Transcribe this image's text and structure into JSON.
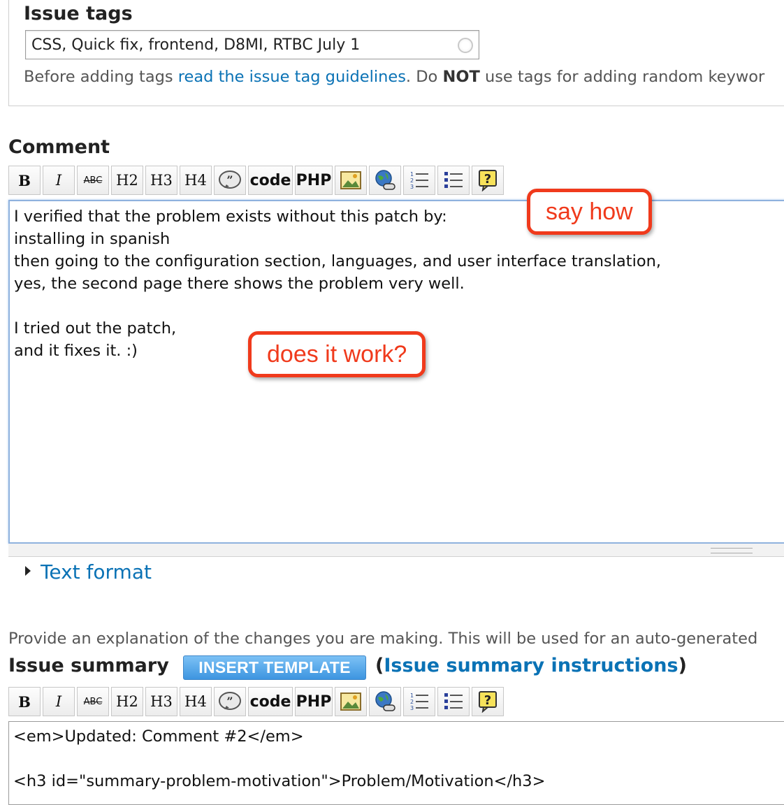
{
  "issue_tags": {
    "label": "Issue tags",
    "value": "CSS, Quick fix, frontend, D8MI, RTBC July 1",
    "help_prefix": "Before adding tags ",
    "help_link": "read the issue tag guidelines",
    "help_mid": ". Do ",
    "help_bold": "NOT",
    "help_suffix": " use tags for adding random keywor"
  },
  "comment": {
    "label": "Comment",
    "text": "I verified that the problem exists without this patch by:\ninstalling in spanish\nthen going to the configuration section, languages, and user interface translation,\nyes, the second page there shows the problem very well.\n\nI tried out the patch,\nand it fixes it. :)"
  },
  "toolbar": {
    "bold": "B",
    "italic": "I",
    "strike": "ABC",
    "h2": "H2",
    "h3": "H3",
    "h4": "H4",
    "code": "code",
    "php": "PHP"
  },
  "icons": [
    "bold-icon",
    "italic-icon",
    "strikethrough-icon",
    "h2-icon",
    "h3-icon",
    "h4-icon",
    "quote-icon",
    "code-icon",
    "php-icon",
    "image-icon",
    "link-icon",
    "ordered-list-icon",
    "bullet-list-icon",
    "help-icon"
  ],
  "callouts": {
    "say_how": "say how",
    "does_it_work": "does it work?"
  },
  "colors": {
    "callout": "#f03a1c",
    "link": "#0a72b5",
    "button": "#3d95e0"
  },
  "text_format": {
    "label": "Text format"
  },
  "summary": {
    "explanation": "Provide an explanation of the changes you are making. This will be used for an auto-generated",
    "label": "Issue summary",
    "insert_button": "INSERT TEMPLATE",
    "instr_open": "(",
    "instr_link": "Issue summary instructions",
    "instr_close": ")",
    "text": "<em>Updated: Comment #2</em>\n\n<h3 id=\"summary-problem-motivation\">Problem/Motivation</h3>"
  }
}
